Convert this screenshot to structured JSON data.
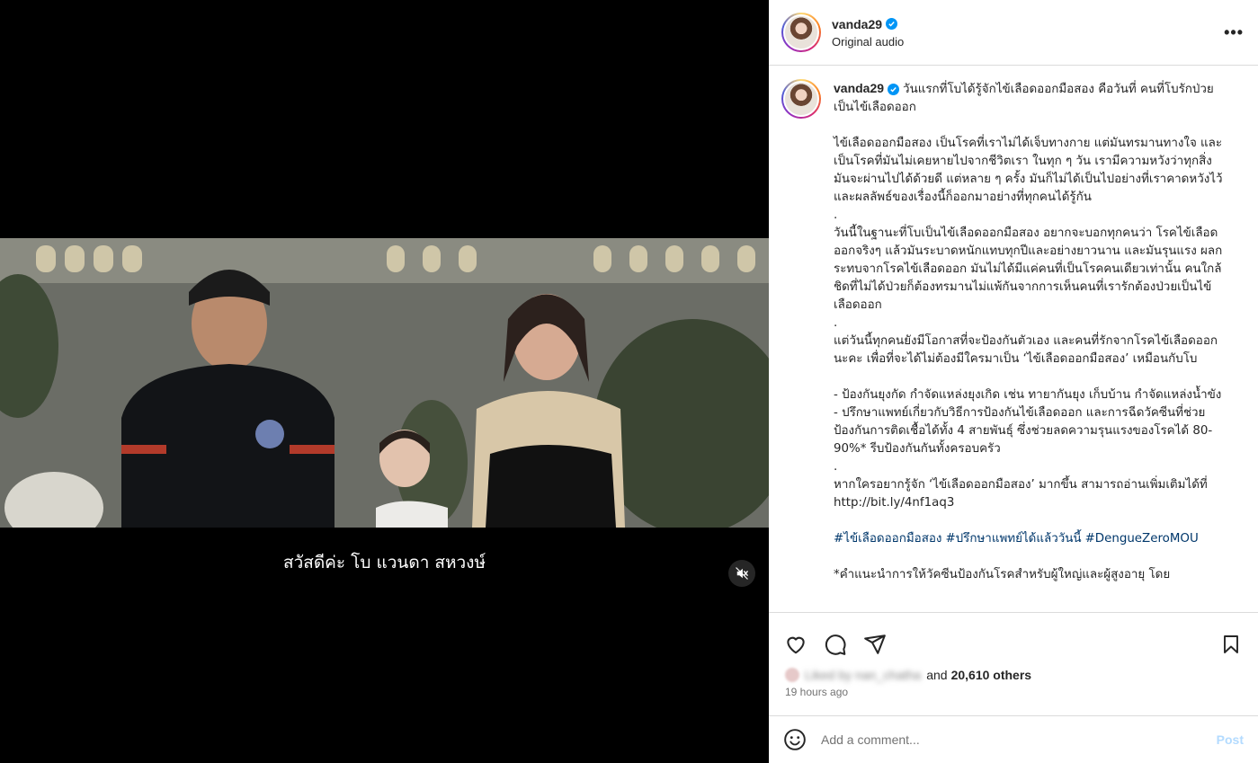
{
  "post": {
    "username": "vanda29",
    "audio": "Original audio",
    "more_label": "•••"
  },
  "media": {
    "subtitle": "สวัสดีค่ะ โบ แวนดา สหวงษ์",
    "mute_icon": "speaker-muted-icon"
  },
  "caption": {
    "username": "vanda29",
    "lead": "วันแรกที่โบได้รู้จักไข้เลือดออกมือสอง คือวันที่ คนที่โบรักป่วยเป็นไข้เลือดออก",
    "p1": "ไข้เลือดออกมือสอง เป็นโรคที่เราไม่ได้เจ็บทางกาย แต่มันทรมานทางใจ และเป็นโรคที่มันไม่เคยหายไปจากชีวิตเรา ในทุก ๆ วัน เรามีความหวังว่าทุกสิ่งมันจะผ่านไปได้ด้วยดี แต่หลาย ๆ ครั้ง มันก็ไม่ได้เป็นไปอย่างที่เราคาดหวังไว้ และผลลัพธ์ของเรื่องนี้ก็ออกมาอย่างที่ทุกคนได้รู้กัน",
    "dot1": ".",
    "p2": "วันนี้ในฐานะที่โบเป็นไข้เลือดออกมือสอง อยากจะบอกทุกคนว่า โรคไข้เลือดออกจริงๆ แล้วมันระบาดหนักแทบทุกปีและอย่างยาวนาน และมันรุนแรง ผลกระทบจากโรคไข้เลือดออก มันไม่ได้มีแค่คนที่เป็นโรคคนเดียวเท่านั้น คนใกล้ชิดที่ไม่ได้ป่วยก็ต้องทรมานไม่แพ้กันจากการเห็นคนที่เรารักต้องป่วยเป็นไข้เลือดออก",
    "dot2": ".",
    "p3": "แต่วันนี้ทุกคนยังมีโอกาสที่จะป้องกันตัวเอง และคนที่รักจากโรคไข้เลือดออกนะคะ เพื่อที่จะได้ไม่ต้องมีใครมาเป็น ‘ไข้เลือดออกมือสอง’ เหมือนกับโบ",
    "b1": "- ป้องกันยุงกัด กำจัดแหล่งยุงเกิด เช่น ทายากันยุง เก็บบ้าน กำจัดแหล่งน้ำขัง",
    "b2": "- ปรึกษาแพทย์เกี่ยวกับวิธีการป้องกันไข้เลือดออก และการฉีดวัคซีนที่ช่วยป้องกันการติดเชื้อได้ทั้ง 4 สายพันธุ์ ซึ่งช่วยลดความรุนแรงของโรคได้ 80-90%* รีบป้องกันกันทั้งครอบครัว",
    "dot3": ".",
    "p4": "หากใครอยากรู้จัก ‘ไข้เลือดออกมือสอง’ มากขึ้น สามารถอ่านเพิ่มเติมได้ที่ http://bit.ly/4nf1aq3",
    "hashtags": [
      "#ไข้เลือดออกมือสอง",
      "#ปรึกษาแพทย์ได้แล้ววันนี้",
      "#DengueZeroMOU"
    ],
    "footnote": "*คำแนะนำการให้วัคซีนป้องกันโรคสำหรับผู้ใหญ่และผู้สูงอายุ โดย"
  },
  "likes": {
    "liked_by_blurred": "Liked by nan_chatha",
    "and": "and",
    "count": "20,610 others"
  },
  "time": "19 hours ago",
  "comment": {
    "placeholder": "Add a comment...",
    "post_label": "Post"
  }
}
